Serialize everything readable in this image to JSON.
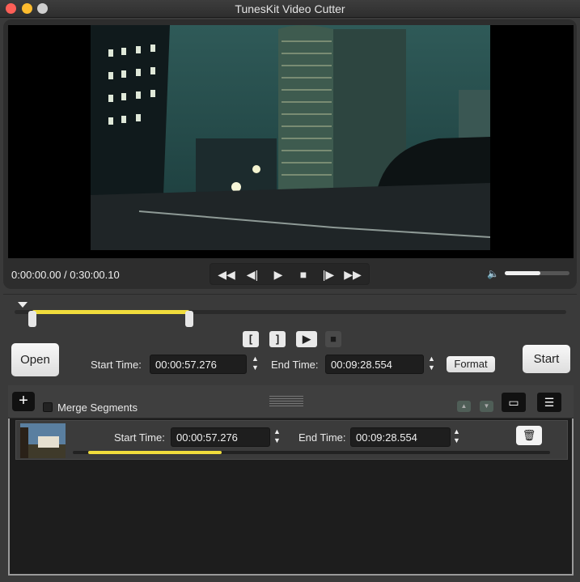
{
  "window": {
    "title": "TunesKit Video Cutter"
  },
  "player": {
    "time_readout": "0:00:00.00 / 0:30:00.10",
    "volume_level": 0.55,
    "controls": [
      "first-frame",
      "previous-frame",
      "play",
      "stop",
      "next-frame",
      "last-frame"
    ]
  },
  "cutter": {
    "open_label": "Open",
    "start_time_label": "Start Time:",
    "start_time_value": "00:00:57.276",
    "end_time_label": "End Time:",
    "end_time_value": "00:09:28.554",
    "format_label": "Format",
    "start_label": "Start",
    "selection_start_fraction": 0.032,
    "selection_end_fraction": 0.316
  },
  "segments_toolbar": {
    "merge_label": "Merge Segments",
    "merge_checked": false
  },
  "segments": [
    {
      "start_time_label": "Start Time:",
      "start_time_value": "00:00:57.276",
      "end_time_label": "End Time:",
      "end_time_value": "00:09:28.554",
      "progress": 0.28
    }
  ],
  "colors": {
    "accent_yellow": "#f0dc3c",
    "window_bg": "#3a3a3a",
    "field_bg": "#1e1e1e"
  }
}
